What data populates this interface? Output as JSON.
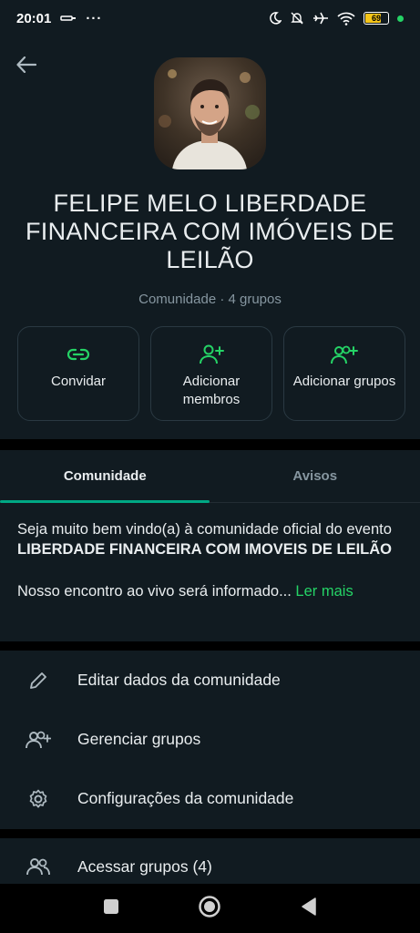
{
  "status_bar": {
    "time": "20:01",
    "battery": "69"
  },
  "community": {
    "name": "FELIPE MELO LIBERDADE FINANCEIRA COM IMÓVEIS DE LEILÃO",
    "meta": "Comunidade · 4 grupos"
  },
  "actions": [
    {
      "label": "Convidar",
      "icon": "link-icon"
    },
    {
      "label": "Adicionar membros",
      "icon": "add-person-icon"
    },
    {
      "label": "Adicionar grupos",
      "icon": "add-group-icon"
    }
  ],
  "tabs": [
    {
      "label": "Comunidade",
      "active": true
    },
    {
      "label": "Avisos",
      "active": false
    }
  ],
  "description": {
    "prefix": "Seja muito bem vindo(a) à comunidade oficial do evento ",
    "bold": "LIBERDADE FINANCEIRA COM IMOVEIS DE LEILÃO",
    "line2": "Nosso encontro ao vivo será informado...",
    "read_more": "Ler mais"
  },
  "menu": [
    {
      "label": "Editar dados da comunidade",
      "icon": "pencil-icon"
    },
    {
      "label": "Gerenciar grupos",
      "icon": "manage-groups-icon"
    },
    {
      "label": "Configurações da comunidade",
      "icon": "gear-icon"
    }
  ],
  "menu2": [
    {
      "label": "Acessar grupos (4)",
      "icon": "groups-icon"
    }
  ],
  "colors": {
    "accent": "#25d366",
    "background": "#111b21",
    "secondary_text": "#8696a0"
  }
}
